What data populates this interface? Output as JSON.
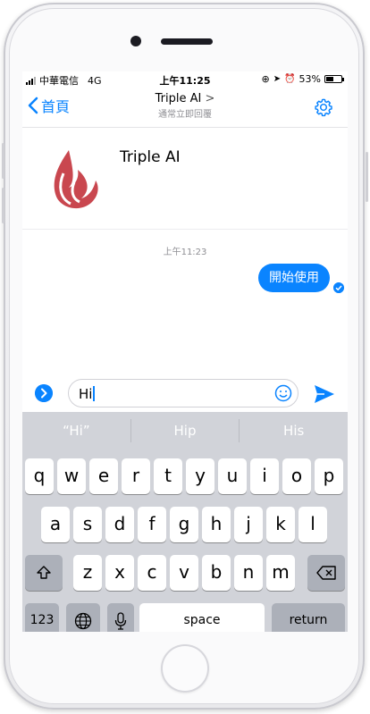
{
  "status_bar": {
    "carrier": "中華電信",
    "network": "4G",
    "time": "上午11:25",
    "battery_percent": "53%",
    "battery_level": 0.53
  },
  "nav": {
    "back_label": "首頁",
    "title": "Triple AI",
    "subtitle": "通常立即回覆"
  },
  "profile": {
    "name": "Triple AI",
    "logo_color": "#c9474f"
  },
  "chat": {
    "timestamp": "上午11:23",
    "messages": [
      {
        "text": "開始使用",
        "from": "me",
        "status": "sent"
      }
    ]
  },
  "composer": {
    "text": "Hi"
  },
  "keyboard": {
    "suggestions": [
      "“Hi”",
      "Hip",
      "His"
    ],
    "row1": [
      "q",
      "w",
      "e",
      "r",
      "t",
      "y",
      "u",
      "i",
      "o",
      "p"
    ],
    "row2": [
      "a",
      "s",
      "d",
      "f",
      "g",
      "h",
      "j",
      "k",
      "l"
    ],
    "row3": [
      "z",
      "x",
      "c",
      "v",
      "b",
      "n",
      "m"
    ],
    "key_123": "123",
    "key_space": "space",
    "key_return": "return"
  },
  "colors": {
    "accent": "#0a84ff",
    "keyboard_bg": "#d1d3d9"
  }
}
